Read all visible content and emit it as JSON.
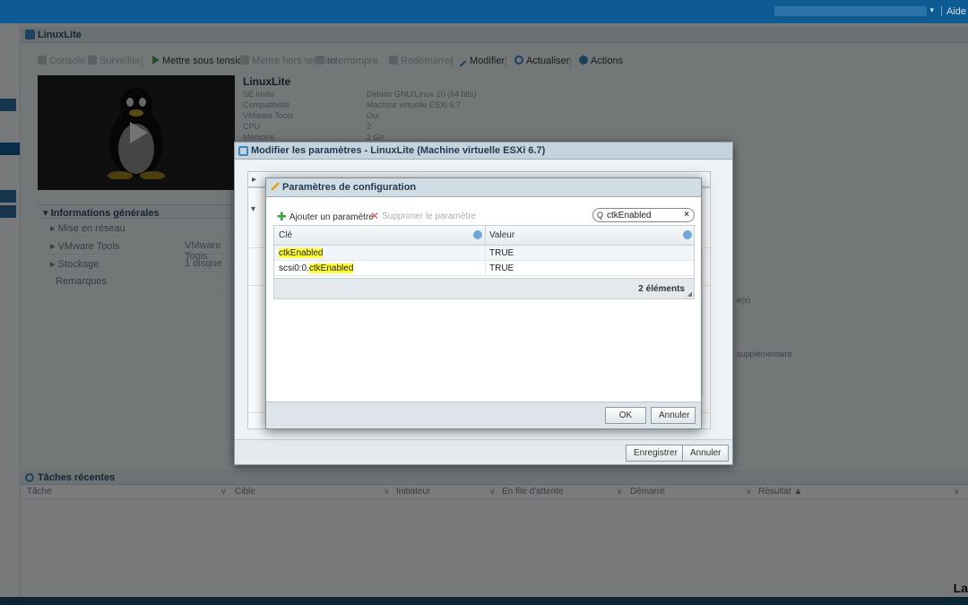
{
  "topbar": {
    "help": "Aide"
  },
  "main": {
    "title": "LinuxLite",
    "toolbar": [
      {
        "label": "Console",
        "enabled": false
      },
      {
        "label": "Surveiller",
        "enabled": false
      },
      {
        "label": "Mettre sous tension",
        "enabled": true
      },
      {
        "label": "Mettre hors tension",
        "enabled": false
      },
      {
        "label": "Interrompre",
        "enabled": false
      },
      {
        "label": "Redémarrer",
        "enabled": false
      },
      {
        "label": "Modifier",
        "enabled": true
      },
      {
        "label": "Actualiser",
        "enabled": true
      },
      {
        "label": "Actions",
        "enabled": true
      }
    ],
    "vm": {
      "name": "LinuxLite",
      "rows": [
        {
          "key": "SE invité",
          "value": "Debian GNU/Linux 10 (64 bits)"
        },
        {
          "key": "Compatibilité",
          "value": "Machine virtuelle ESXi 6.7"
        },
        {
          "key": "VMware Tools",
          "value": "Oui"
        },
        {
          "key": "CPU",
          "value": "2"
        },
        {
          "key": "Mémoire",
          "value": "2 Go"
        }
      ]
    },
    "general": {
      "header": "Informations générales",
      "rows": [
        {
          "label": "Mise en réseau",
          "value": ""
        },
        {
          "label": "VMware Tools",
          "value": "VMware Tools"
        },
        {
          "label": "Stockage",
          "value": "1 disque"
        },
        {
          "label": "Remarques",
          "value": ""
        }
      ]
    },
    "right_texts": [
      "é(s)",
      "supplémentaire"
    ]
  },
  "outer_dialog": {
    "title": "Modifier les paramètres - LinuxLite (Machine virtuelle ESXi 6.7)",
    "save": "Enregistrer",
    "cancel": "Annuler"
  },
  "config_dialog": {
    "title": "Paramètres de configuration",
    "add": "Ajouter un paramètre",
    "remove": "Supprimer le paramètre",
    "search_value": "ctkEnabled",
    "columns": [
      "Clé",
      "Valeur"
    ],
    "rows": [
      {
        "key_prefix": "",
        "key_match": "ctkEnabled",
        "value": "TRUE"
      },
      {
        "key_prefix": "scsi0:0.",
        "key_match": "ctkEnabled",
        "value": "TRUE"
      }
    ],
    "count": "2 éléments",
    "ok": "OK",
    "cancel": "Annuler"
  },
  "tasks": {
    "title": "Tâches récentes",
    "columns": [
      "Tâche",
      "Cible",
      "Initiateur",
      "En file d'attente",
      "Démarré",
      "Résultat ▲"
    ]
  },
  "brand": "La",
  "colors": {
    "accent": "#0e5a92",
    "highlight": "#ffff33",
    "add": "#35a33a",
    "remove": "#e25b4f"
  }
}
